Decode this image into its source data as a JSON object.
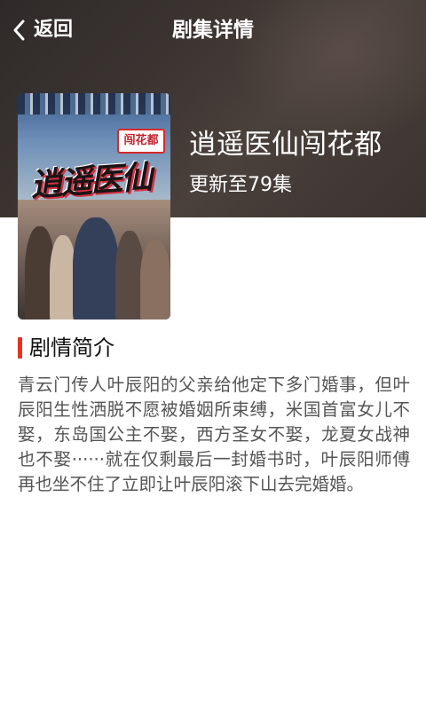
{
  "nav": {
    "back_label": "返回",
    "title": "剧集详情"
  },
  "drama": {
    "title": "逍遥医仙闯花都",
    "episode_status": "更新至79集",
    "poster": {
      "badge_text": "闯花都",
      "logo_text": "逍遥医仙"
    }
  },
  "synopsis_section": {
    "title": "剧情简介",
    "text": "青云门传人叶辰阳的父亲给他定下多门婚事，但叶辰阳生性洒脱不愿被婚姻所束缚，米国首富女儿不娶，东岛国公主不娶，西方圣女不娶，龙夏女战神也不娶······就在仅剩最后一封婚书时，叶辰阳师傅再也坐不住了立即让叶辰阳滚下山去完婚婚。"
  },
  "colors": {
    "header_bg": "#3a3331",
    "accent": "#e8321e",
    "synopsis_text": "#555555"
  },
  "icons": {
    "back": "chevron-left-icon"
  }
}
